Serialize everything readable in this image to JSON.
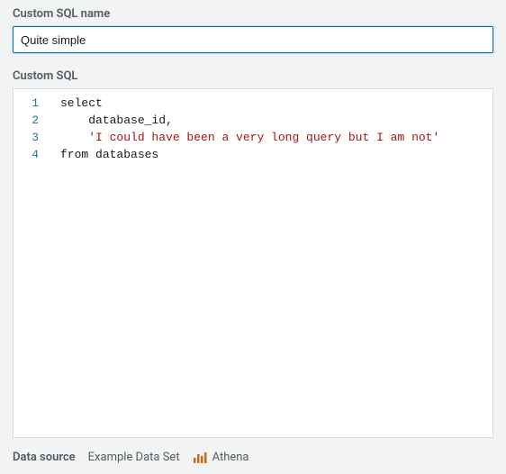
{
  "labels": {
    "custom_sql_name": "Custom SQL name",
    "custom_sql": "Custom SQL",
    "data_source": "Data source"
  },
  "name_input": {
    "value": "Quite simple"
  },
  "sql": {
    "lines": [
      {
        "n": "1",
        "tokens": [
          {
            "cls": "tok-keyword",
            "t": "select"
          }
        ]
      },
      {
        "n": "2",
        "tokens": [
          {
            "cls": "tok-ident",
            "t": "    database_id,"
          }
        ]
      },
      {
        "n": "3",
        "tokens": [
          {
            "cls": "tok-ident",
            "t": "    "
          },
          {
            "cls": "tok-string",
            "t": "'I could have been a very long query but I am not'"
          }
        ]
      },
      {
        "n": "4",
        "tokens": [
          {
            "cls": "tok-keyword",
            "t": "from "
          },
          {
            "cls": "tok-ident",
            "t": "databases"
          }
        ]
      }
    ]
  },
  "footer": {
    "dataset_name": "Example Data Set",
    "engine": "Athena"
  }
}
